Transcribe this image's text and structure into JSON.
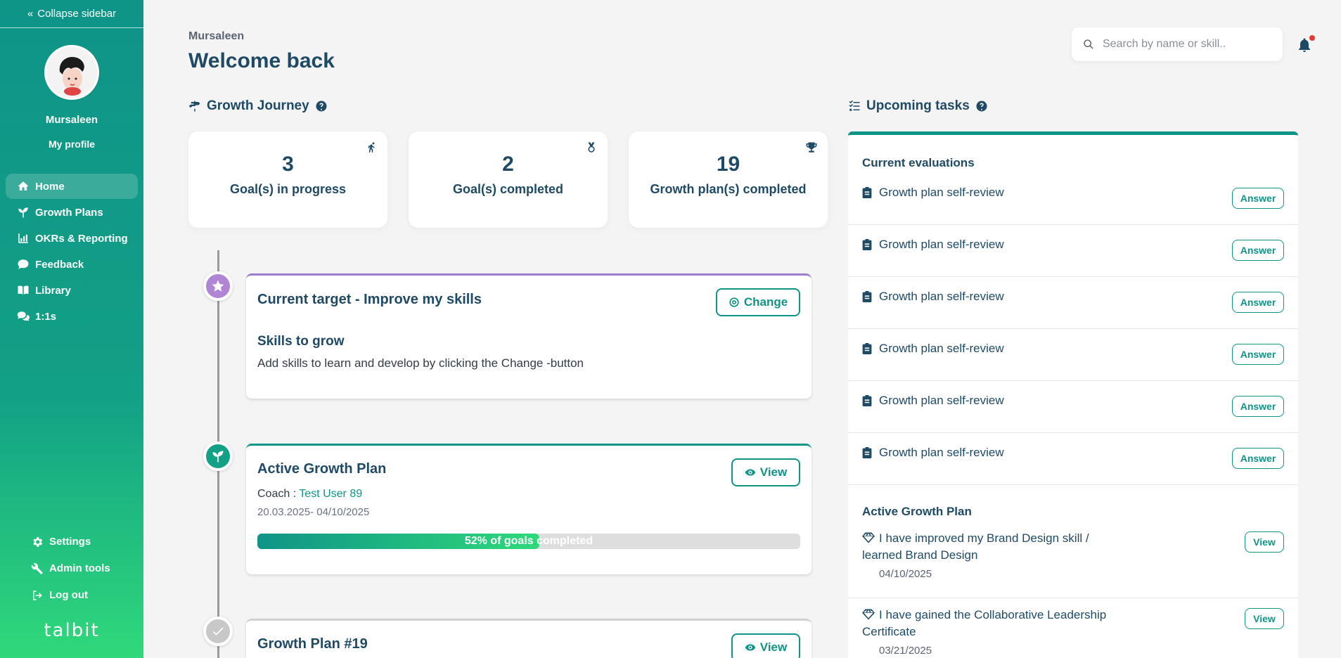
{
  "sidebar": {
    "collapse_label": "Collapse sidebar",
    "user_name": "Mursaleen",
    "profile_link": "My profile",
    "nav": [
      {
        "label": "Home",
        "icon": "home-icon"
      },
      {
        "label": "Growth Plans",
        "icon": "sprout-icon"
      },
      {
        "label": "OKRs & Reporting",
        "icon": "bar-chart-icon"
      },
      {
        "label": "Feedback",
        "icon": "chat-icon"
      },
      {
        "label": "Library",
        "icon": "book-icon"
      },
      {
        "label": "1:1s",
        "icon": "comments-icon"
      }
    ],
    "bottom_nav": [
      {
        "label": "Settings",
        "icon": "gear-icon"
      },
      {
        "label": "Admin tools",
        "icon": "tools-icon"
      },
      {
        "label": "Log out",
        "icon": "logout-icon"
      }
    ],
    "logo": "talbit"
  },
  "header": {
    "user_name": "Mursaleen",
    "welcome": "Welcome back",
    "search_placeholder": "Search by name or skill.."
  },
  "growth_journey": {
    "title": "Growth Journey",
    "stats": [
      {
        "value": "3",
        "label": "Goal(s) in progress",
        "icon": "running-icon"
      },
      {
        "value": "2",
        "label": "Goal(s) completed",
        "icon": "medal-icon"
      },
      {
        "value": "19",
        "label": "Growth plan(s) completed",
        "icon": "trophy-icon"
      }
    ],
    "target_card": {
      "title": "Current target - Improve my skills",
      "button": "Change",
      "subtitle": "Skills to grow",
      "text": "Add skills to learn and develop by clicking the Change -button"
    },
    "active_plan_card": {
      "title": "Active Growth Plan",
      "button": "View",
      "coach_label": "Coach :",
      "coach_name": "Test User 89",
      "dates": "20.03.2025- 04/10/2025",
      "progress": 0.52,
      "progress_text": "52% of goals completed"
    },
    "plan19_card": {
      "title": "Growth Plan #19",
      "button": "View"
    }
  },
  "upcoming_tasks": {
    "title": "Upcoming tasks",
    "evaluations_title": "Current evaluations",
    "evaluations": [
      {
        "label": "Growth plan self-review",
        "button": "Answer"
      },
      {
        "label": "Growth plan self-review",
        "button": "Answer"
      },
      {
        "label": "Growth plan self-review",
        "button": "Answer"
      },
      {
        "label": "Growth plan self-review",
        "button": "Answer"
      },
      {
        "label": "Growth plan self-review",
        "button": "Answer"
      },
      {
        "label": "Growth plan self-review",
        "button": "Answer"
      }
    ],
    "active_plan_title": "Active Growth Plan",
    "goals": [
      {
        "text": "I have improved my Brand Design skill / learned Brand Design",
        "date": "04/10/2025",
        "button": "View"
      },
      {
        "text": "I have gained the Collaborative Leadership Certificate",
        "date": "03/21/2025",
        "button": "View"
      }
    ]
  },
  "colors": {
    "accent": "#0f9488",
    "accent_light": "#2fd97a",
    "text_dark": "#1f4a66",
    "target_card_border": "#9c7bd0",
    "page_background": "#f5f4f4"
  }
}
